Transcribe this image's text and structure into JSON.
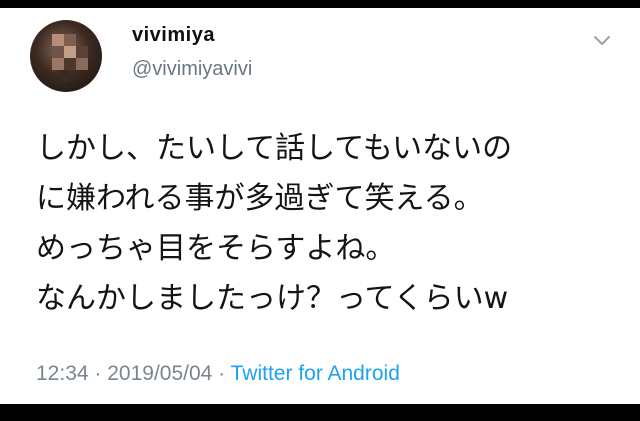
{
  "tweet": {
    "author": {
      "display_name": "vivimiya",
      "handle": "@vivimiyavivi"
    },
    "lines": [
      "しかし、たいして話してもいないの",
      "に嫌われる事が多過ぎて笑える。",
      "めっちゃ目をそらすよね。",
      "なんかしましたっけ？ってくらいw"
    ],
    "time": "12:34",
    "separator_1": " · ",
    "date": "2019/05/04",
    "separator_2": " · ",
    "source": "Twitter for Android"
  },
  "colors": {
    "source_link": "#1da1f2",
    "meta_text": "#7a868f",
    "body_text": "#141414"
  },
  "icons": {
    "menu": "chevron-down-icon"
  }
}
